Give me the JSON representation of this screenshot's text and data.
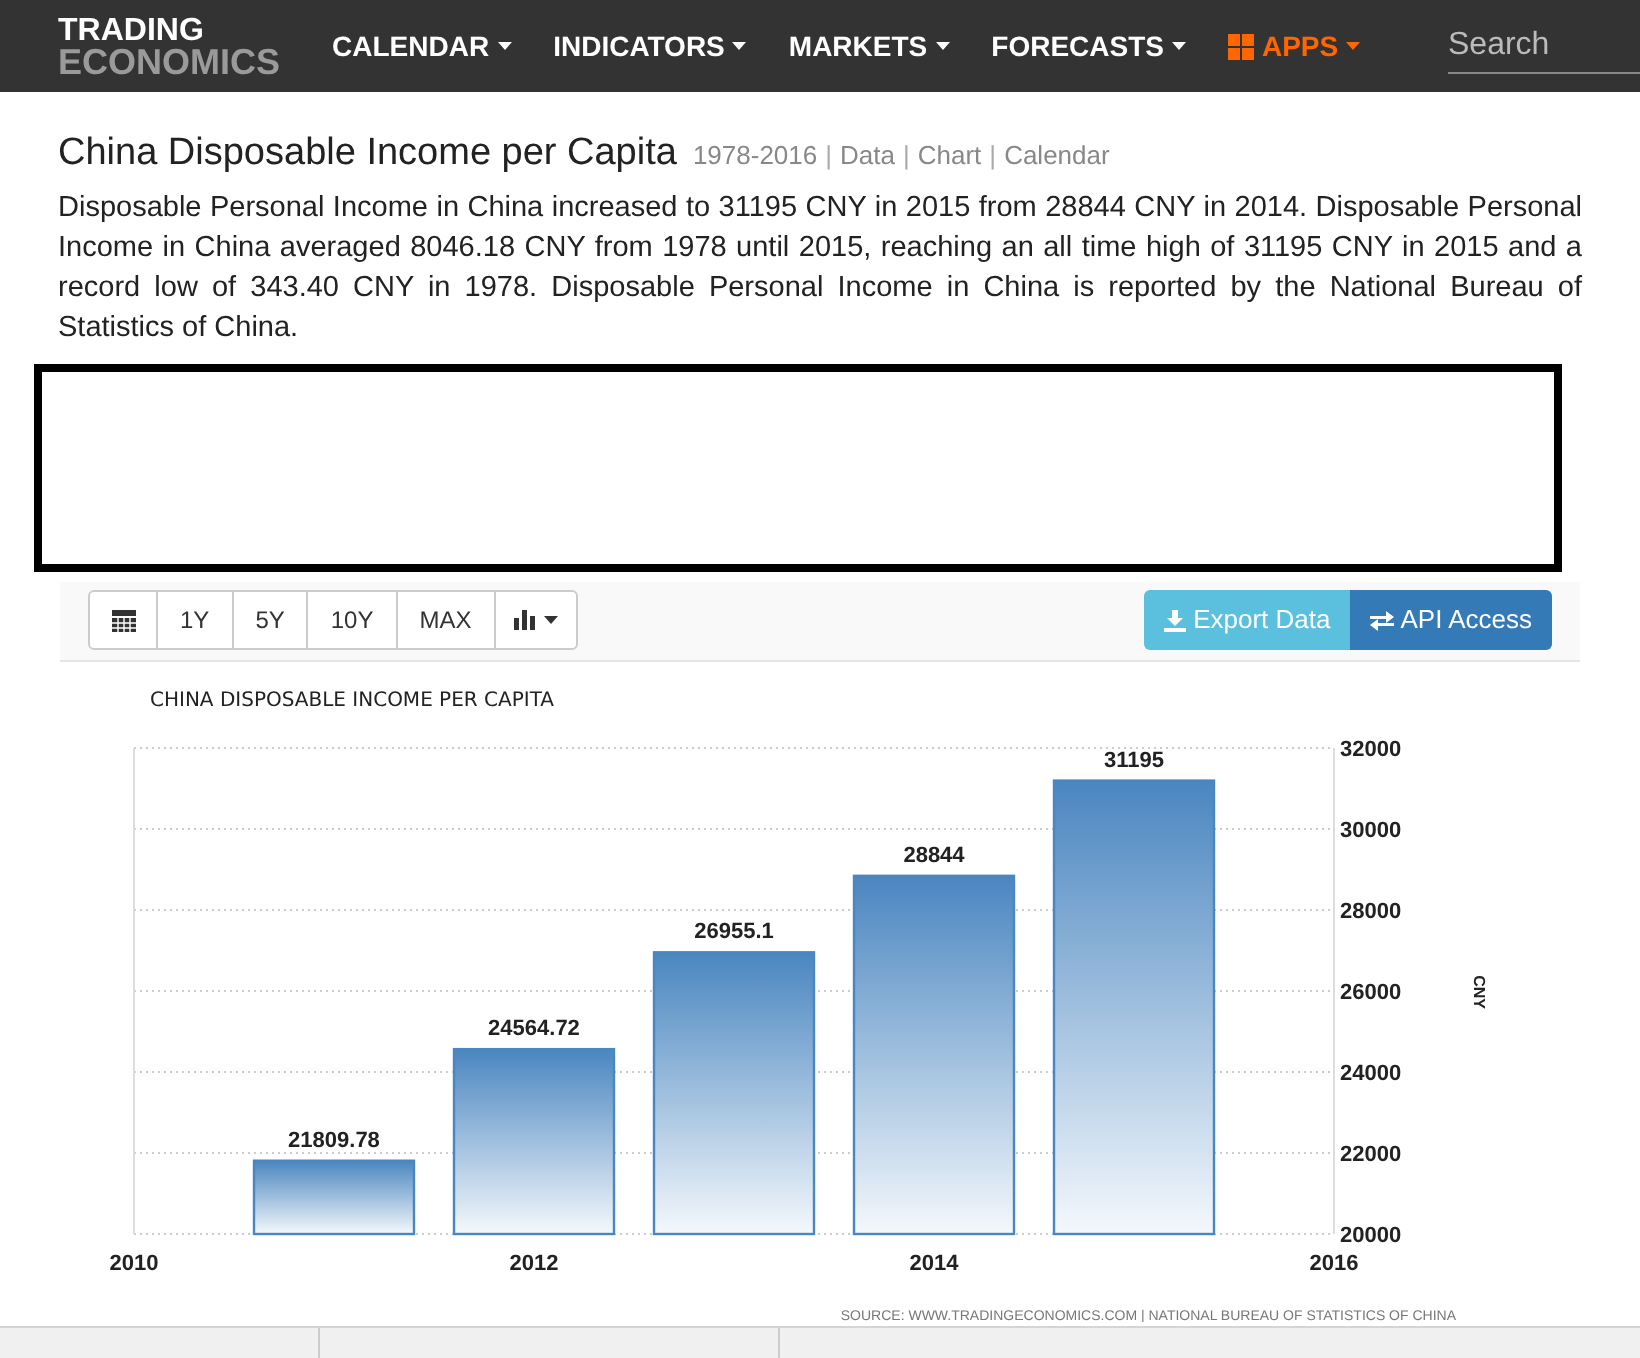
{
  "nav": {
    "logo_top": "TRADING",
    "logo_bottom": "ECONOMICS",
    "items": [
      {
        "label": "CALENDAR",
        "kind": "menu"
      },
      {
        "label": "INDICATORS",
        "kind": "menu"
      },
      {
        "label": "MARKETS",
        "kind": "menu"
      },
      {
        "label": "FORECASTS",
        "kind": "menu"
      },
      {
        "label": "APPS",
        "kind": "apps"
      }
    ],
    "search": {
      "placeholder": "Search"
    }
  },
  "header": {
    "title": "China Disposable Income per Capita",
    "range": "1978-2016",
    "links": [
      "Data",
      "Chart",
      "Calendar"
    ],
    "separator": "|"
  },
  "description": "Disposable Personal Income in China increased to 31195 CNY in 2015 from 28844 CNY in 2014. Disposable Personal Income in China averaged 8046.18 CNY from 1978 until 2015, reaching an all time high of 31195 CNY in 2015 and a record low of 343.40 CNY in 1978. Disposable Personal Income in China is reported by the National Bureau of Statistics of China.",
  "toolbar": {
    "ranges": [
      {
        "label": "1Y"
      },
      {
        "label": "5Y"
      },
      {
        "label": "10Y"
      },
      {
        "label": "MAX"
      }
    ],
    "export": "Export Data",
    "api": "API Access"
  },
  "chart": {
    "chart_data": {
      "type": "bar",
      "title": "CHINA DISPOSABLE INCOME PER CAPITA",
      "ylabel": "CNY",
      "x": [
        2011,
        2012,
        2013,
        2014,
        2015
      ],
      "series": [
        {
          "color": "#4a86c0",
          "values": [
            21809.78,
            24564.72,
            26955.1,
            28844,
            31195
          ]
        }
      ],
      "grid": true,
      "xlim": [
        2010,
        2016
      ],
      "ylim": [
        20000,
        32000
      ],
      "xticks": [
        2010,
        2012,
        2014,
        2016
      ],
      "yticks": [
        20000,
        22000,
        24000,
        26000,
        28000,
        30000,
        32000
      ],
      "value_labels": [
        "21809.78",
        "24564.72",
        "26955.1",
        "28844",
        "31195"
      ]
    },
    "source": "SOURCE: WWW.TRADINGECONOMICS.COM | NATIONAL BUREAU OF STATISTICS OF CHINA"
  }
}
